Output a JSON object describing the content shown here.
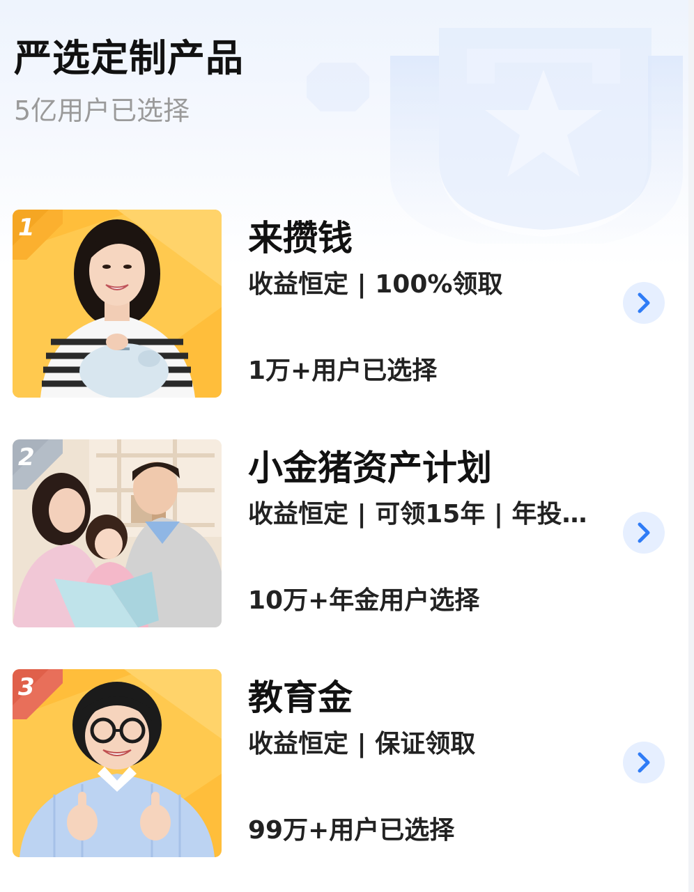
{
  "header": {
    "title": "严选定制产品",
    "subtitle": "5亿用户已选择"
  },
  "products": [
    {
      "rank": "1",
      "name": "来攒钱",
      "tags": "收益恒定 | 100%领取",
      "users": "1万+用户已选择",
      "image": "woman-with-piggy-bank",
      "badge_color": "#f5a623"
    },
    {
      "rank": "2",
      "name": "小金猪资产计划",
      "tags": "收益恒定 | 可领15年 | 年投…",
      "users": "10万+年金用户选择",
      "image": "family-reading-book",
      "badge_color": "#a9b2bd"
    },
    {
      "rank": "3",
      "name": "教育金",
      "tags": "收益恒定 | 保证领取",
      "users": "99万+用户已选择",
      "image": "boy-thumbs-up",
      "badge_color": "#e0604a"
    }
  ],
  "icons": {
    "arrow": "chevron-right-icon",
    "emblem": "shield-star-icon"
  },
  "colors": {
    "accent_blue": "#2f7cf6",
    "arrow_bg": "#e6efff",
    "photo_orange": "#ffbe3b"
  }
}
